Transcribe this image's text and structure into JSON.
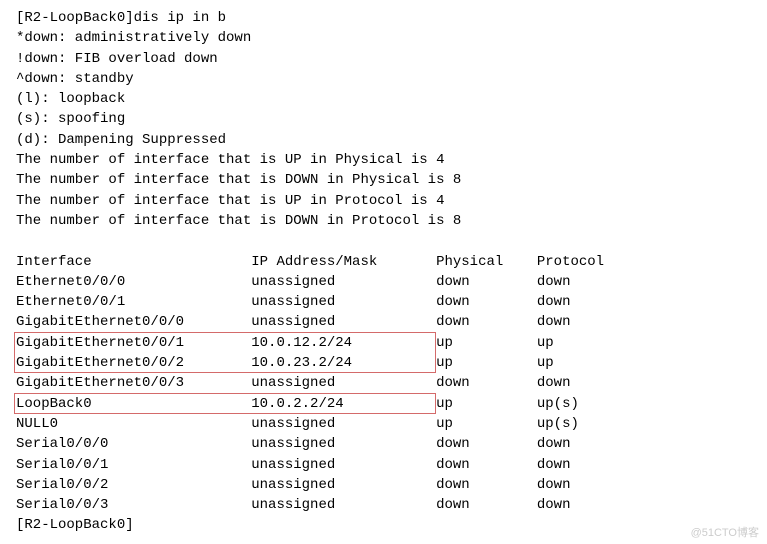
{
  "header": {
    "prompt_line": "[R2-LoopBack0]dis ip in b",
    "legend": [
      "*down: administratively down",
      "!down: FIB overload down",
      "^down: standby",
      "(l): loopback",
      "(s): spoofing",
      "(d): Dampening Suppressed"
    ],
    "counts": [
      "The number of interface that is UP in Physical is 4",
      "The number of interface that is DOWN in Physical is 8",
      "The number of interface that is UP in Protocol is 4",
      "The number of interface that is DOWN in Protocol is 8"
    ]
  },
  "table": {
    "columns": {
      "interface": "Interface",
      "ip": "IP Address/Mask",
      "physical": "Physical",
      "protocol": "Protocol"
    },
    "rows": [
      {
        "interface": "Ethernet0/0/0",
        "ip": "unassigned",
        "physical": "down",
        "protocol": "down"
      },
      {
        "interface": "Ethernet0/0/1",
        "ip": "unassigned",
        "physical": "down",
        "protocol": "down"
      },
      {
        "interface": "GigabitEthernet0/0/0",
        "ip": "unassigned",
        "physical": "down",
        "protocol": "down"
      },
      {
        "interface": "GigabitEthernet0/0/1",
        "ip": "10.0.12.2/24",
        "physical": "up",
        "protocol": "up"
      },
      {
        "interface": "GigabitEthernet0/0/2",
        "ip": "10.0.23.2/24",
        "physical": "up",
        "protocol": "up"
      },
      {
        "interface": "GigabitEthernet0/0/3",
        "ip": "unassigned",
        "physical": "down",
        "protocol": "down"
      },
      {
        "interface": "LoopBack0",
        "ip": "10.0.2.2/24",
        "physical": "up",
        "protocol": "up(s)"
      },
      {
        "interface": "NULL0",
        "ip": "unassigned",
        "physical": "up",
        "protocol": "up(s)"
      },
      {
        "interface": "Serial0/0/0",
        "ip": "unassigned",
        "physical": "down",
        "protocol": "down"
      },
      {
        "interface": "Serial0/0/1",
        "ip": "unassigned",
        "physical": "down",
        "protocol": "down"
      },
      {
        "interface": "Serial0/0/2",
        "ip": "unassigned",
        "physical": "down",
        "protocol": "down"
      },
      {
        "interface": "Serial0/0/3",
        "ip": "unassigned",
        "physical": "down",
        "protocol": "down"
      }
    ]
  },
  "footer": {
    "prompt": "[R2-LoopBack0]"
  },
  "watermark": "@51CTO博客",
  "highlights": {
    "box1": {
      "top_row": 4,
      "row_span": 2
    },
    "box2": {
      "top_row": 7,
      "row_span": 1
    }
  }
}
